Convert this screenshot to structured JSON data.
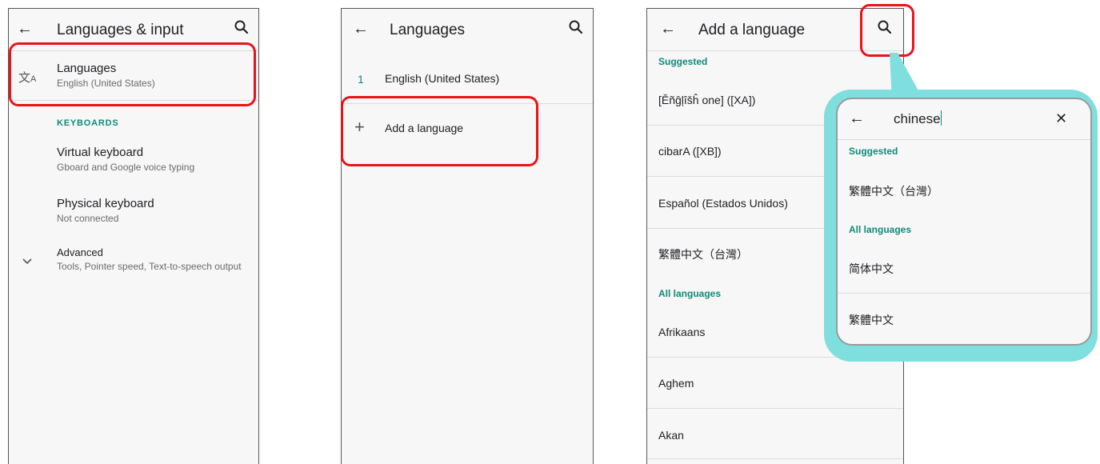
{
  "screen1": {
    "title": "Languages & input",
    "languages_title": "Languages",
    "languages_subtitle": "English (United States)",
    "keyboards_header": "KEYBOARDS",
    "virtual_title": "Virtual keyboard",
    "virtual_subtitle": "Gboard and Google voice typing",
    "physical_title": "Physical keyboard",
    "physical_subtitle": "Not connected",
    "advanced_title": "Advanced",
    "advanced_subtitle": "Tools, Pointer speed, Text-to-speech output"
  },
  "screen2": {
    "title": "Languages",
    "lang_number": "1",
    "lang_name": "English (United States)",
    "add_icon": "+",
    "add_label": "Add a language"
  },
  "screen3": {
    "title": "Add a language",
    "suggested_header": "Suggested",
    "suggested": [
      "[Ěñĝļîšĥ one] ([XA])",
      "cibarA ([XB])",
      "Español (Estados Unidos)",
      "繁體中文（台灣）"
    ],
    "all_header": "All languages",
    "all": [
      "Afrikaans",
      "Aghem",
      "Akan"
    ]
  },
  "popup": {
    "query": "chinese",
    "clear_icon": "✕",
    "suggested_header": "Suggested",
    "suggested": [
      "繁體中文（台灣）"
    ],
    "all_header": "All languages",
    "all": [
      "简体中文",
      "繁體中文"
    ]
  },
  "icons": {
    "back": "arrow-left-icon",
    "search": "search-icon",
    "translate": "translate-icon",
    "expand": "chevron-down-icon",
    "add": "plus-icon",
    "clear": "close-icon"
  },
  "colors": {
    "highlight": "#e8141b",
    "accent_teal": "#0d8a7a",
    "callout": "#7fdede",
    "background": "#f7f7f7"
  }
}
